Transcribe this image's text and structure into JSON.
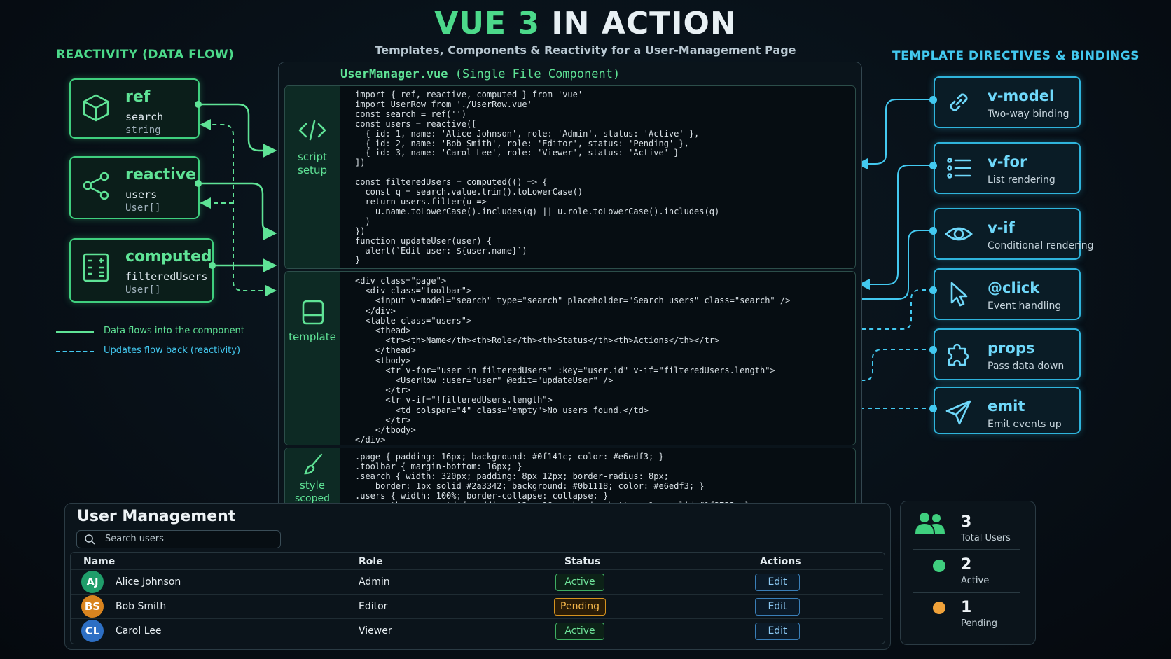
{
  "header": {
    "title_part1": "VUE 3",
    "title_part2": "IN ACTION",
    "subtitle": "Templates, Components & Reactivity for a User-Management Page"
  },
  "left_section": {
    "title": "REACTIVITY (DATA FLOW)",
    "cards": [
      {
        "name": "ref",
        "sub1": "search",
        "sub2": "string",
        "icon": "cube-icon"
      },
      {
        "name": "reactive",
        "sub1": "users",
        "sub2": "User[]",
        "icon": "share-nodes-icon"
      },
      {
        "name": "computed",
        "sub1": "filteredUsers",
        "sub2": "User[]",
        "icon": "calculator-icon"
      }
    ],
    "legend": {
      "solid": "Data flows into the component",
      "dashed": "Updates flow back (reactivity)"
    }
  },
  "sfc": {
    "filename": "UserManager.vue",
    "filetype": "(Single File Component)",
    "script_label_1": "script",
    "script_label_2": "setup",
    "template_label": "template",
    "style_label_1": "style",
    "style_label_2": "scoped",
    "script_code": "import { ref, reactive, computed } from 'vue'\nimport UserRow from './UserRow.vue'\nconst search = ref('')\nconst users = reactive([\n  { id: 1, name: 'Alice Johnson', role: 'Admin', status: 'Active' },\n  { id: 2, name: 'Bob Smith', role: 'Editor', status: 'Pending' },\n  { id: 3, name: 'Carol Lee', role: 'Viewer', status: 'Active' }\n])\n\nconst filteredUsers = computed(() => {\n  const q = search.value.trim().toLowerCase()\n  return users.filter(u =>\n    u.name.toLowerCase().includes(q) || u.role.toLowerCase().includes(q)\n  )\n})\nfunction updateUser(user) {\n  alert(`Edit user: ${user.name}`)\n}",
    "template_code": "<div class=\"page\">\n  <div class=\"toolbar\">\n    <input v-model=\"search\" type=\"search\" placeholder=\"Search users\" class=\"search\" />\n  </div>\n  <table class=\"users\">\n    <thead>\n      <tr><th>Name</th><th>Role</th><th>Status</th><th>Actions</th></tr>\n    </thead>\n    <tbody>\n      <tr v-for=\"user in filteredUsers\" :key=\"user.id\" v-if=\"filteredUsers.length\">\n        <UserRow :user=\"user\" @edit=\"updateUser\" />\n      </tr>\n      <tr v-if=\"!filteredUsers.length\">\n        <td colspan=\"4\" class=\"empty\">No users found.</td>\n      </tr>\n    </tbody>\n</div>",
    "style_code": ".page { padding: 16px; background: #0f141c; color: #e6edf3; }\n.toolbar { margin-bottom: 16px; }\n.search { width: 320px; padding: 8px 12px; border-radius: 8px;\n    border: 1px solid #2a3342; background: #0b1118; color: #e6edf3; }\n.users { width: 100%; border-collapse: collapse; }\n.users th, .users td { padding: 12px 16px; border-bottom: 1px solid #1f2733; }\n.empty { text-align: center; padding: 24px; color: #8b949e; }"
  },
  "right_section": {
    "title": "TEMPLATE DIRECTIVES & BINDINGS",
    "cards": [
      {
        "name": "v-model",
        "desc": "Two-way binding",
        "icon": "link-icon"
      },
      {
        "name": "v-for",
        "desc": "List rendering",
        "icon": "list-icon"
      },
      {
        "name": "v-if",
        "desc": "Conditional rendering",
        "icon": "eye-icon"
      },
      {
        "name": "@click",
        "desc": "Event handling",
        "icon": "cursor-icon"
      },
      {
        "name": "props",
        "desc": "Pass data down",
        "icon": "puzzle-icon"
      },
      {
        "name": "emit",
        "desc": "Emit events up",
        "icon": "send-icon"
      }
    ]
  },
  "user_management": {
    "title": "User Management",
    "search_placeholder": "Search users",
    "columns": [
      "Name",
      "Role",
      "Status",
      "Actions"
    ],
    "rows": [
      {
        "initials": "AJ",
        "name": "Alice Johnson",
        "role": "Admin",
        "status": "Active",
        "action": "Edit",
        "avatar_color": "#1f9d6a"
      },
      {
        "initials": "BS",
        "name": "Bob Smith",
        "role": "Editor",
        "status": "Pending",
        "action": "Edit",
        "avatar_color": "#d9841f"
      },
      {
        "initials": "CL",
        "name": "Carol Lee",
        "role": "Viewer",
        "status": "Active",
        "action": "Edit",
        "avatar_color": "#2d6fc4"
      }
    ]
  },
  "stats": [
    {
      "value": "3",
      "label": "Total Users",
      "icon": "users-icon",
      "color": "#3fcf7e"
    },
    {
      "value": "2",
      "label": "Active",
      "icon": "green-dot-icon",
      "color": "#3fcf7e"
    },
    {
      "value": "1",
      "label": "Pending",
      "icon": "orange-dot-icon",
      "color": "#f0a23a"
    }
  ],
  "colors": {
    "green_accent": "#4cd98a",
    "blue_accent": "#43c9f0",
    "background": "#070e15"
  }
}
